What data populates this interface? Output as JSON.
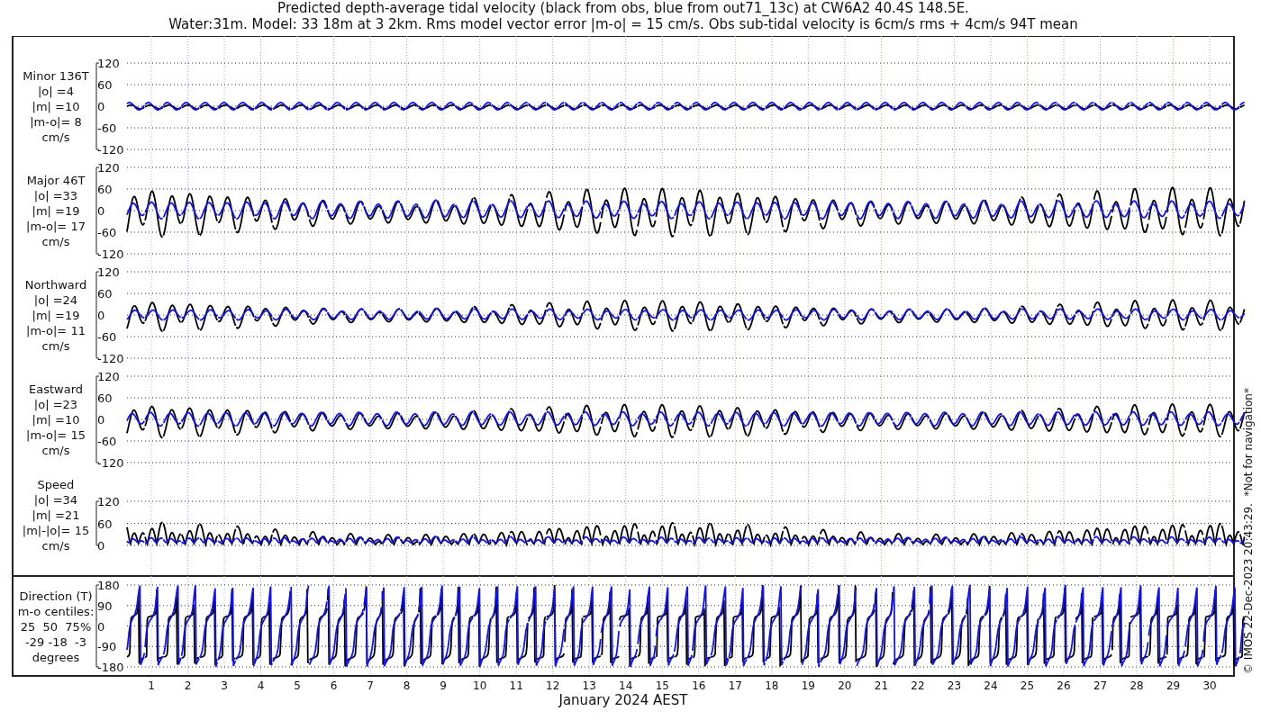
{
  "title": [
    "Predicted depth-average tidal velocity (black from obs, blue from out71_13c) at CW6A2 40.4S 148.5E.",
    "Water:31m. Model: 33 18m at 3 2km. Rms model vector error |m-o| = 15 cm/s. Obs sub-tidal velocity is 6cm/s rms + 4cm/s 94T mean"
  ],
  "panels": [
    {
      "kind": "signed",
      "label": [
        "Minor 136T",
        "|o| =4",
        "|m| =10",
        "|m-o|= 8",
        "cm/s"
      ],
      "yticks": [
        "120",
        "60",
        "0",
        "-60",
        "-120"
      ]
    },
    {
      "kind": "signed",
      "label": [
        "Major 46T",
        "|o| =33",
        "|m| =19",
        "|m-o|= 17",
        "cm/s"
      ],
      "yticks": [
        "120",
        "60",
        "0",
        "-60",
        "-120"
      ]
    },
    {
      "kind": "signed",
      "label": [
        "Northward",
        "|o| =24",
        "|m| =19",
        "|m-o|= 11",
        "cm/s"
      ],
      "yticks": [
        "120",
        "60",
        "0",
        "-60",
        "-120"
      ]
    },
    {
      "kind": "signed",
      "label": [
        "Eastward",
        "|o| =23",
        "|m| =10",
        "|m-o|= 15",
        "cm/s"
      ],
      "yticks": [
        "120",
        "60",
        "0",
        "-60",
        "-120"
      ]
    },
    {
      "kind": "speed",
      "label": [
        "Speed",
        "|o| =34",
        "|m| =21",
        "|m|-|o|= 15",
        "cm/s"
      ],
      "yticks": [
        "120",
        "60",
        "0"
      ]
    },
    {
      "kind": "direction",
      "label": [
        "Direction (T)",
        "m-o centiles:",
        "25  50  75%",
        "-29 -18  -3",
        "degrees"
      ],
      "yticks": [
        "180",
        "90",
        "0",
        "-90",
        "-180"
      ]
    }
  ],
  "xticks": [
    "1",
    "2",
    "3",
    "4",
    "5",
    "6",
    "7",
    "8",
    "9",
    "10",
    "11",
    "12",
    "13",
    "14",
    "15",
    "16",
    "17",
    "18",
    "19",
    "20",
    "21",
    "22",
    "23",
    "24",
    "25",
    "26",
    "27",
    "28",
    "29",
    "30"
  ],
  "xlabel": "January 2024 AEST",
  "credit": "© IMOS 22-Dec-2023 20:43:29.  *Not for navigation*"
}
